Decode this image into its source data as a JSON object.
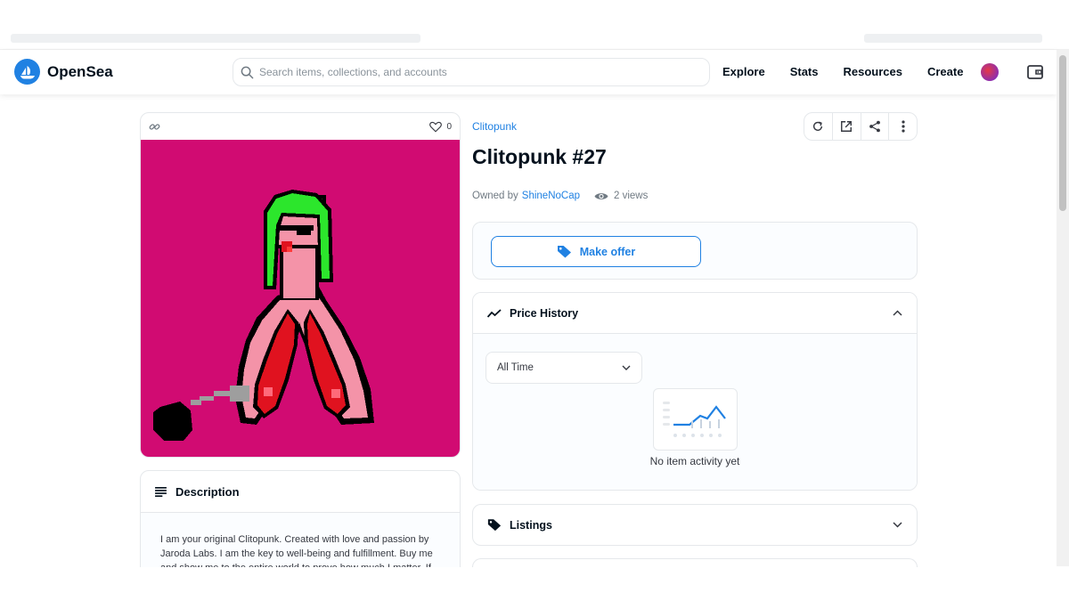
{
  "brand": {
    "name": "OpenSea",
    "color": "#2081e2"
  },
  "search": {
    "placeholder": "Search items, collections, and accounts"
  },
  "nav": {
    "links": [
      "Explore",
      "Stats",
      "Resources",
      "Create"
    ]
  },
  "item": {
    "collection": "Clitopunk",
    "title": "Clitopunk #27",
    "owned_by_label": "Owned by",
    "owner": "ShineNoCap",
    "views": "2 views",
    "favorites": "0",
    "image_bg": "#d10b72"
  },
  "offer": {
    "label": "Make offer"
  },
  "price_history": {
    "title": "Price History",
    "range_selected": "All Time",
    "empty_text": "No item activity yet"
  },
  "listings": {
    "title": "Listings"
  },
  "description": {
    "title": "Description",
    "text": "I am your original Clitopunk. Created with love and passion by Jaroda Labs. I am the key to well-being and fulfillment. Buy me and show me to the entire world to prove how much I matter. If"
  },
  "icons": [
    "search-icon",
    "refresh-icon",
    "external-link-icon",
    "share-icon",
    "more-icon",
    "link-icon",
    "heart-icon",
    "eye-icon",
    "tag-icon",
    "trend-icon",
    "chevron-up-icon",
    "chevron-down-icon",
    "list-icon",
    "wallet-icon"
  ]
}
